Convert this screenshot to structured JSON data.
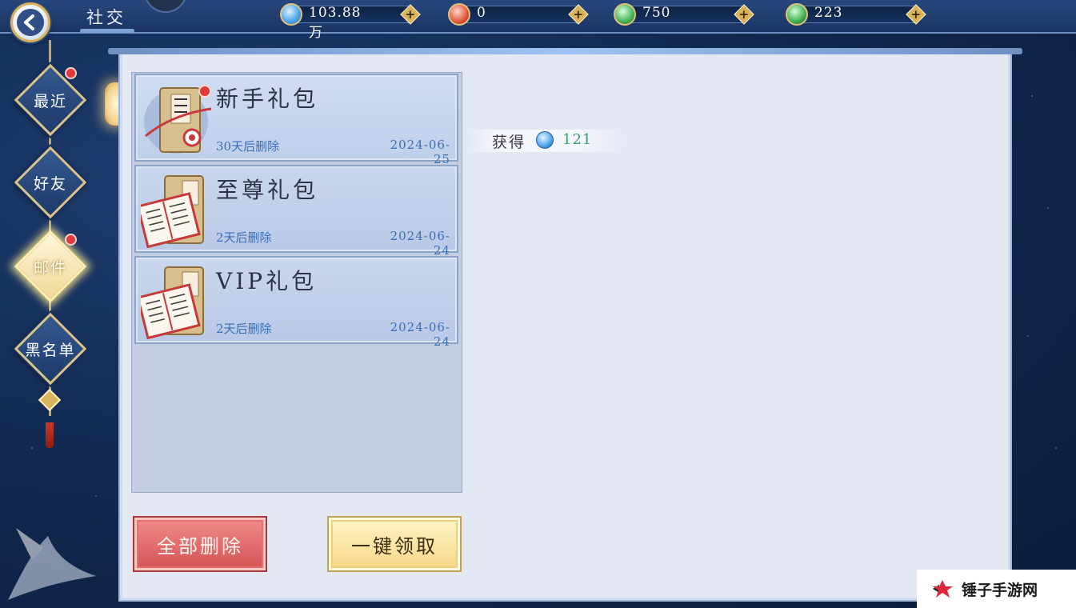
{
  "header": {
    "title": "社交",
    "currencies": [
      {
        "name": "diamond",
        "value": "103.88万",
        "icon": "diamond-icon",
        "color": "#4aa3e8"
      },
      {
        "name": "red-gem",
        "value": "0",
        "icon": "red-gem-icon",
        "color": "#e0573a"
      },
      {
        "name": "jade-coin",
        "value": "750",
        "icon": "jade-coin-icon",
        "color": "#47b35a"
      },
      {
        "name": "jade-coin-2",
        "value": "223",
        "icon": "jade-coin-icon",
        "color": "#3fae52"
      }
    ],
    "plus_label": "+"
  },
  "sidebar": {
    "items": [
      {
        "label": "最近",
        "active": false,
        "badge": true
      },
      {
        "label": "好友",
        "active": false,
        "badge": false
      },
      {
        "label": "邮件",
        "active": true,
        "badge": true
      },
      {
        "label": "黑名单",
        "active": false,
        "badge": false
      }
    ]
  },
  "mail": {
    "items": [
      {
        "title": "新手礼包",
        "expire": "30天后删除",
        "date": "2024-06-25",
        "unread": true,
        "selected": true
      },
      {
        "title": "至尊礼包",
        "expire": "2天后删除",
        "date": "2024-06-24",
        "unread": false,
        "selected": false
      },
      {
        "title": "VIP礼包",
        "expire": "2天后删除",
        "date": "2024-06-24",
        "unread": false,
        "selected": false
      }
    ],
    "reward": {
      "label": "获得",
      "icon": "diamond-icon",
      "amount": "121"
    }
  },
  "actions": {
    "delete_all": "全部删除",
    "claim_all": "一键领取"
  },
  "watermark": {
    "text": "锤子手游网"
  },
  "colors": {
    "accent_gold": "#d9b25a",
    "delete_red": "#d55454",
    "claim_gold": "#f6d98a",
    "expire_blue": "#3a6fb6",
    "reward_green": "#2fa36a"
  }
}
